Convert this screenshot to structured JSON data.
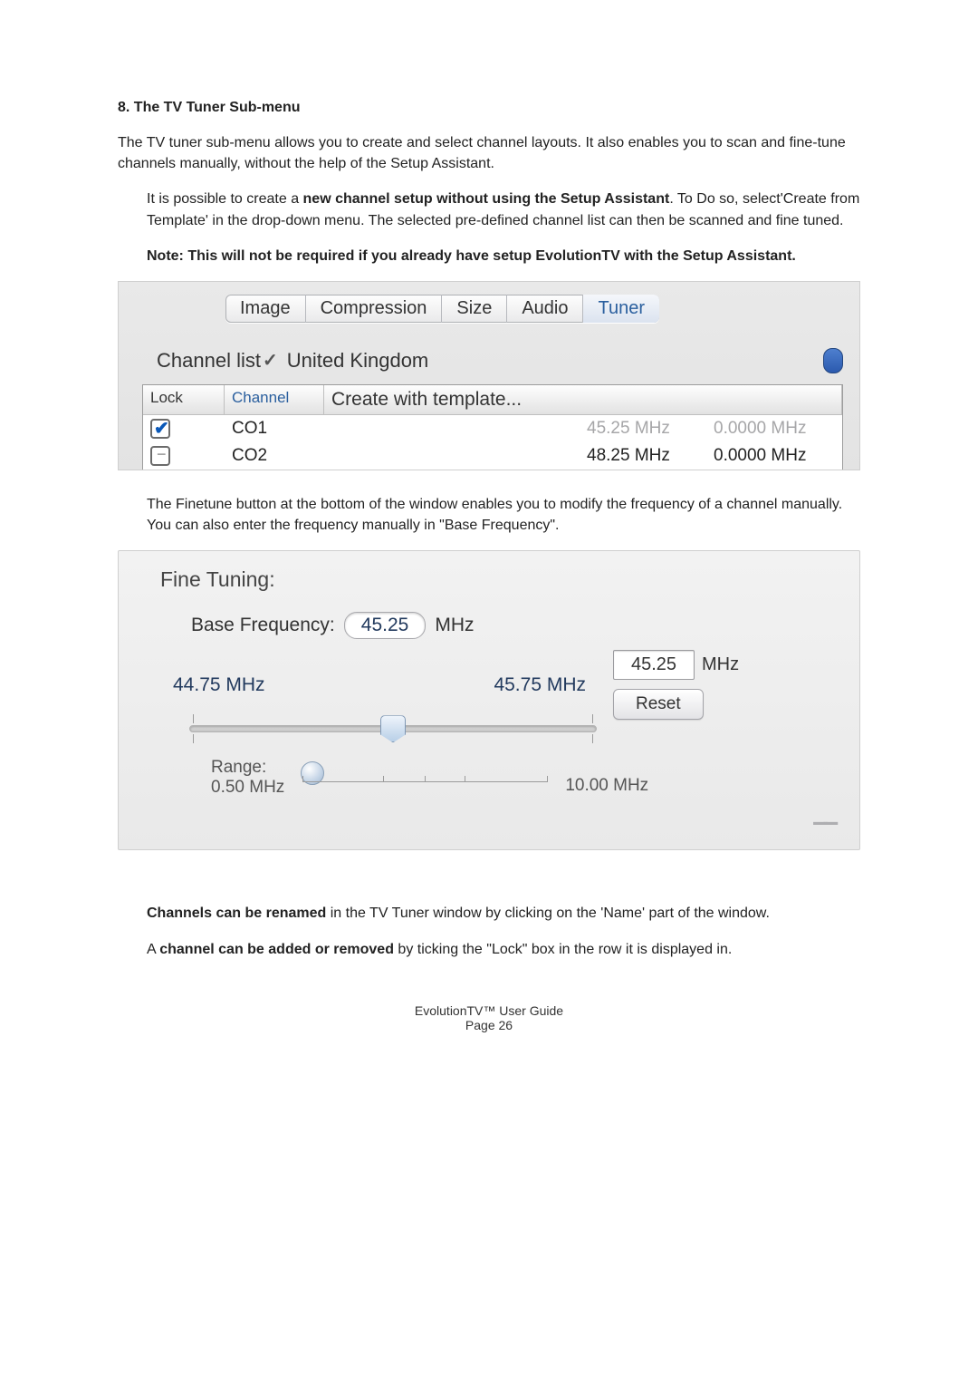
{
  "heading": "8.   The TV Tuner Sub-menu",
  "intro": "The TV tuner sub-menu allows you to create and select channel layouts. It also enables you to scan and fine-tune channels manually, without the help of the Setup Assistant.",
  "block1": {
    "p1a": "It is possible to create a ",
    "p1b": "new channel setup without using the Setup Assistant",
    "p1c": ". To Do so, select'Create from Template' in the drop-down menu. The selected pre-defined channel list can then be scanned and  fine tuned.",
    "note_bold": "Note:   This will not be required if you already have setup EvolutionTV with the Setup Assistant."
  },
  "shot1": {
    "tabs": [
      "Image",
      "Compression",
      "Size",
      "Audio",
      "Tuner"
    ],
    "active_tab": 4,
    "channel_list_label": "Channel list",
    "selected_country": "United Kingdom",
    "dropdown_item": "Create with template...",
    "columns": {
      "lock": "Lock",
      "channel": "Channel"
    },
    "rows": [
      {
        "locked": true,
        "channel": "CO1",
        "freq": "45.25 MHz",
        "fine": "0.0000 MHz",
        "ghost": true
      },
      {
        "locked": false,
        "channel": "CO2",
        "freq": "48.25 MHz",
        "fine": "0.0000 MHz",
        "ghost": false
      }
    ]
  },
  "mid": "The Finetune button at the bottom of the window enables you to modify the frequency of a channel manually. You can also enter the frequency manually in \"Base Frequency\".",
  "shot2": {
    "title": "Fine Tuning:",
    "base_label": "Base Frequency:",
    "base_value": "45.25",
    "base_unit": "MHz",
    "scale_min": "44.75 MHz",
    "scale_max": "45.75 MHz",
    "current_value": "45.25",
    "current_unit": "MHz",
    "reset": "Reset",
    "range_label": "Range:",
    "range_min": "0.50 MHz",
    "range_max": "10.00 MHz"
  },
  "block2": {
    "p2a": "Channels can be renamed",
    "p2b": " in the TV Tuner window by clicking on the 'Name' part of the window.",
    "p3a": "A ",
    "p3b": "channel can be added or removed",
    "p3c": " by ticking the \"Lock\" box in the row it is displayed in."
  },
  "footer": {
    "l1": "EvolutionTV™ User Guide",
    "l2_a": "Page ",
    "l2_b": "26"
  }
}
